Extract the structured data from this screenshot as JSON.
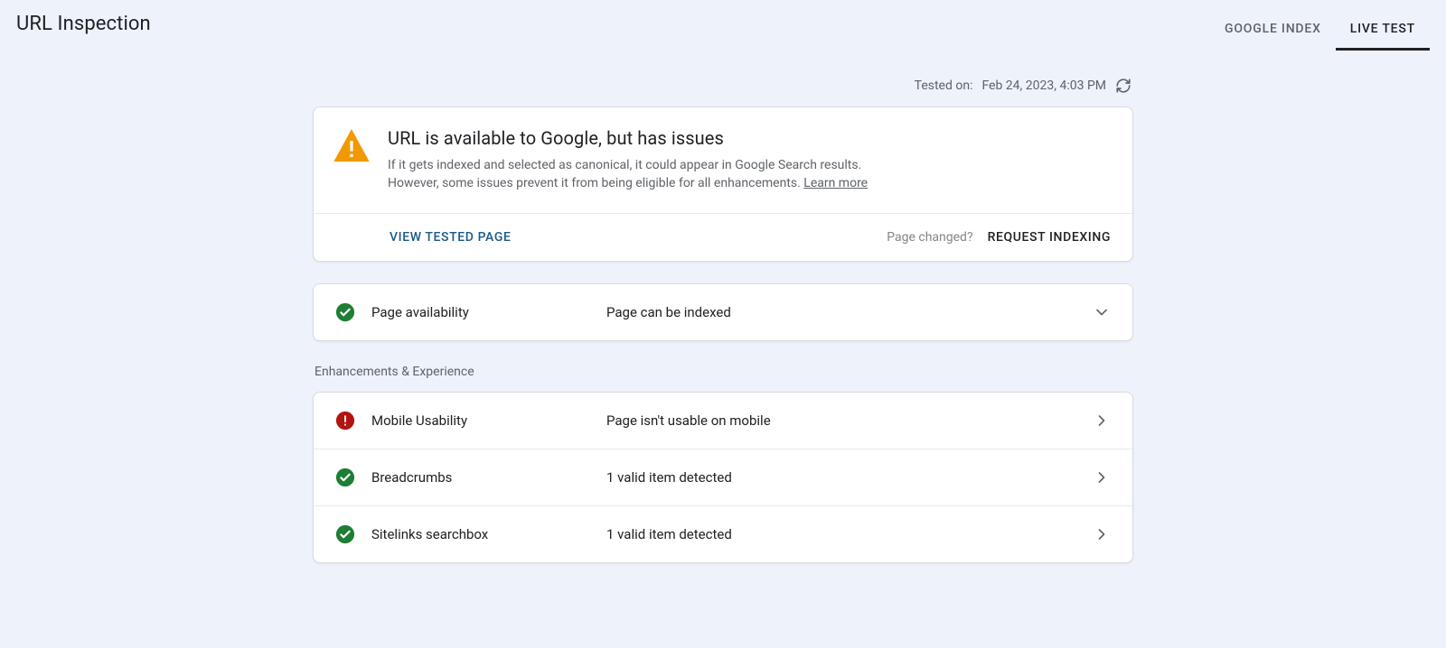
{
  "header": {
    "title": "URL Inspection",
    "tabs": {
      "google_index": "GOOGLE INDEX",
      "live_test": "LIVE TEST"
    }
  },
  "tested": {
    "label": "Tested on:",
    "value": "Feb 24, 2023, 4:03 PM"
  },
  "summary": {
    "title": "URL is available to Google, but has issues",
    "desc1": "If it gets indexed and selected as canonical, it could appear in Google Search results.",
    "desc2": "However, some issues prevent it from being eligible for all enhancements. ",
    "learn_more": "Learn more",
    "view_tested_page": "VIEW TESTED PAGE",
    "page_changed": "Page changed?",
    "request_indexing": "REQUEST INDEXING"
  },
  "page_availability": {
    "label": "Page availability",
    "value": "Page can be indexed"
  },
  "enhancements_label": "Enhancements & Experience",
  "enhancements": [
    {
      "label": "Mobile Usability",
      "value": "Page isn't usable on mobile",
      "status": "error"
    },
    {
      "label": "Breadcrumbs",
      "value": "1 valid item detected",
      "status": "ok"
    },
    {
      "label": "Sitelinks searchbox",
      "value": "1 valid item detected",
      "status": "ok"
    }
  ]
}
